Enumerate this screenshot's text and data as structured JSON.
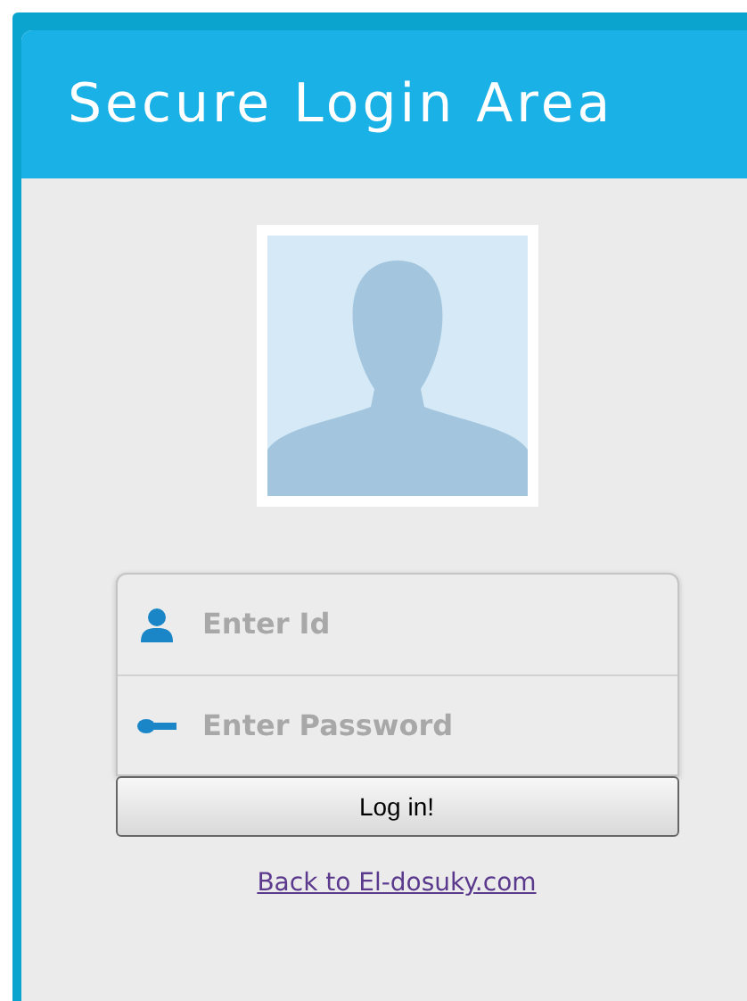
{
  "header": {
    "title": "Secure Login Area"
  },
  "form": {
    "fields": [
      {
        "kind": "user",
        "placeholder": "Enter Id"
      },
      {
        "kind": "password",
        "placeholder": "Enter Password"
      }
    ],
    "submit": "Log in!"
  },
  "link": "Back to El-dosuky.com"
}
